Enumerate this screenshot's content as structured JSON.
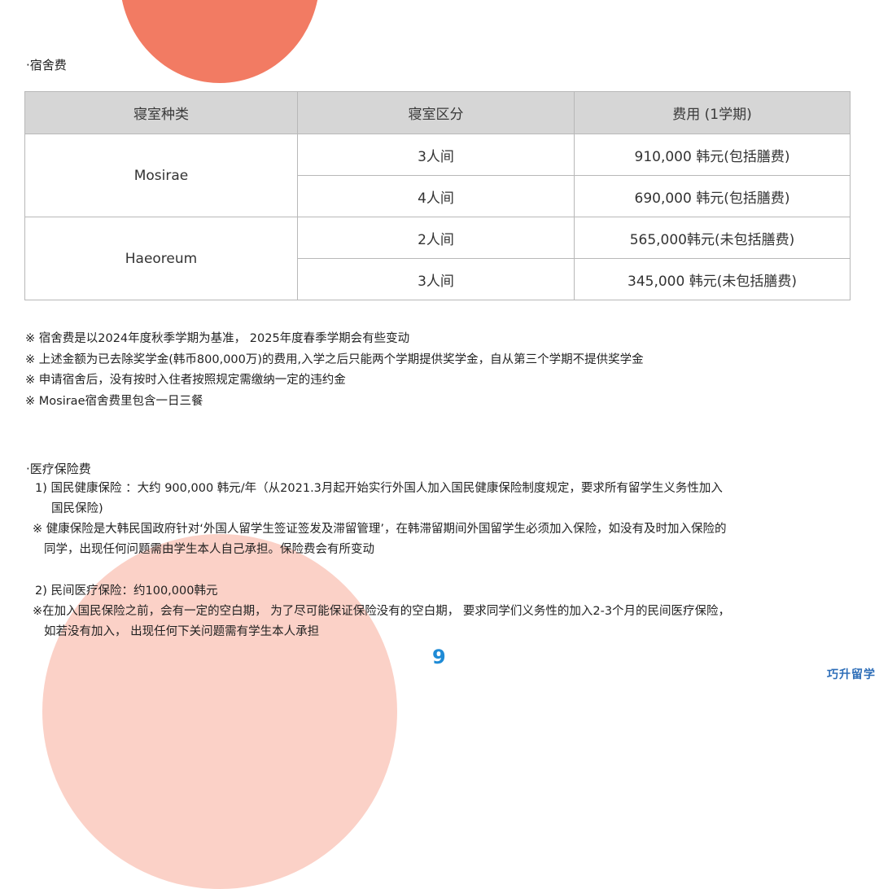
{
  "dorm_section": {
    "title": "·宿舍费",
    "table": {
      "headers": [
        "寝室种类",
        "寝室区分",
        "费用 (1学期)"
      ],
      "groups": [
        {
          "name": "Mosirae",
          "rows": [
            {
              "type": "3人间",
              "fee": "910,000 韩元(包括膳费)"
            },
            {
              "type": "4人间",
              "fee": "690,000 韩元(包括膳费)"
            }
          ]
        },
        {
          "name": "Haeoreum",
          "rows": [
            {
              "type": "2人间",
              "fee": "565,000韩元(未包括膳费)"
            },
            {
              "type": "3人间",
              "fee": "345,000 韩元(未包括膳费)"
            }
          ]
        }
      ]
    },
    "notes": [
      "※ 宿舍费是以2024年度秋季学期为基准， 2025年度春季学期会有些变动",
      "※ 上述金额为已去除奖学金(韩币800,000万)的费用,入学之后只能两个学期提供奖学金，自从第三个学期不提供奖学金",
      "※ 申请宿舍后，没有按时入住者按照规定需缴纳一定的违约金",
      "※ Mosirae宿舍费里包含一日三餐"
    ]
  },
  "medical_section": {
    "title": "·医疗保险费",
    "item1_line1": "1) 国民健康保险 ：大约 900,000 韩元/年（从2021.3月起开始实行外国人加入国民健康保险制度规定，要求所有留学生义务性加入",
    "item1_line2": "国民保险)",
    "item1_note_line1": "※ 健康保险是大韩民国政府针对‘外国人留学生签证签发及滞留管理’，在韩滞留期间外国留学生必须加入保险，如没有及时加入保险的",
    "item1_note_line2": "同学，出现任何问题需由学生本人自己承担。保险费会有所变动",
    "item2": "2) 民间医疗保险：约100,000韩元",
    "item2_note_line1": "※在加入国民保险之前，会有一定的空白期， 为了尽可能保证保险没有的空白期， 要求同学们义务性的加入2-3个月的民间医疗保险，",
    "item2_note_line2": "如若没有加入， 出现任何下关问题需有学生本人承担"
  },
  "page_number": "9",
  "watermark": "巧升留学",
  "colors": {
    "accent_orange": "#f27b63",
    "accent_pink": "#fbd1c7",
    "page_number_blue": "#1f8bd6",
    "table_header_gray": "#d6d6d6"
  }
}
